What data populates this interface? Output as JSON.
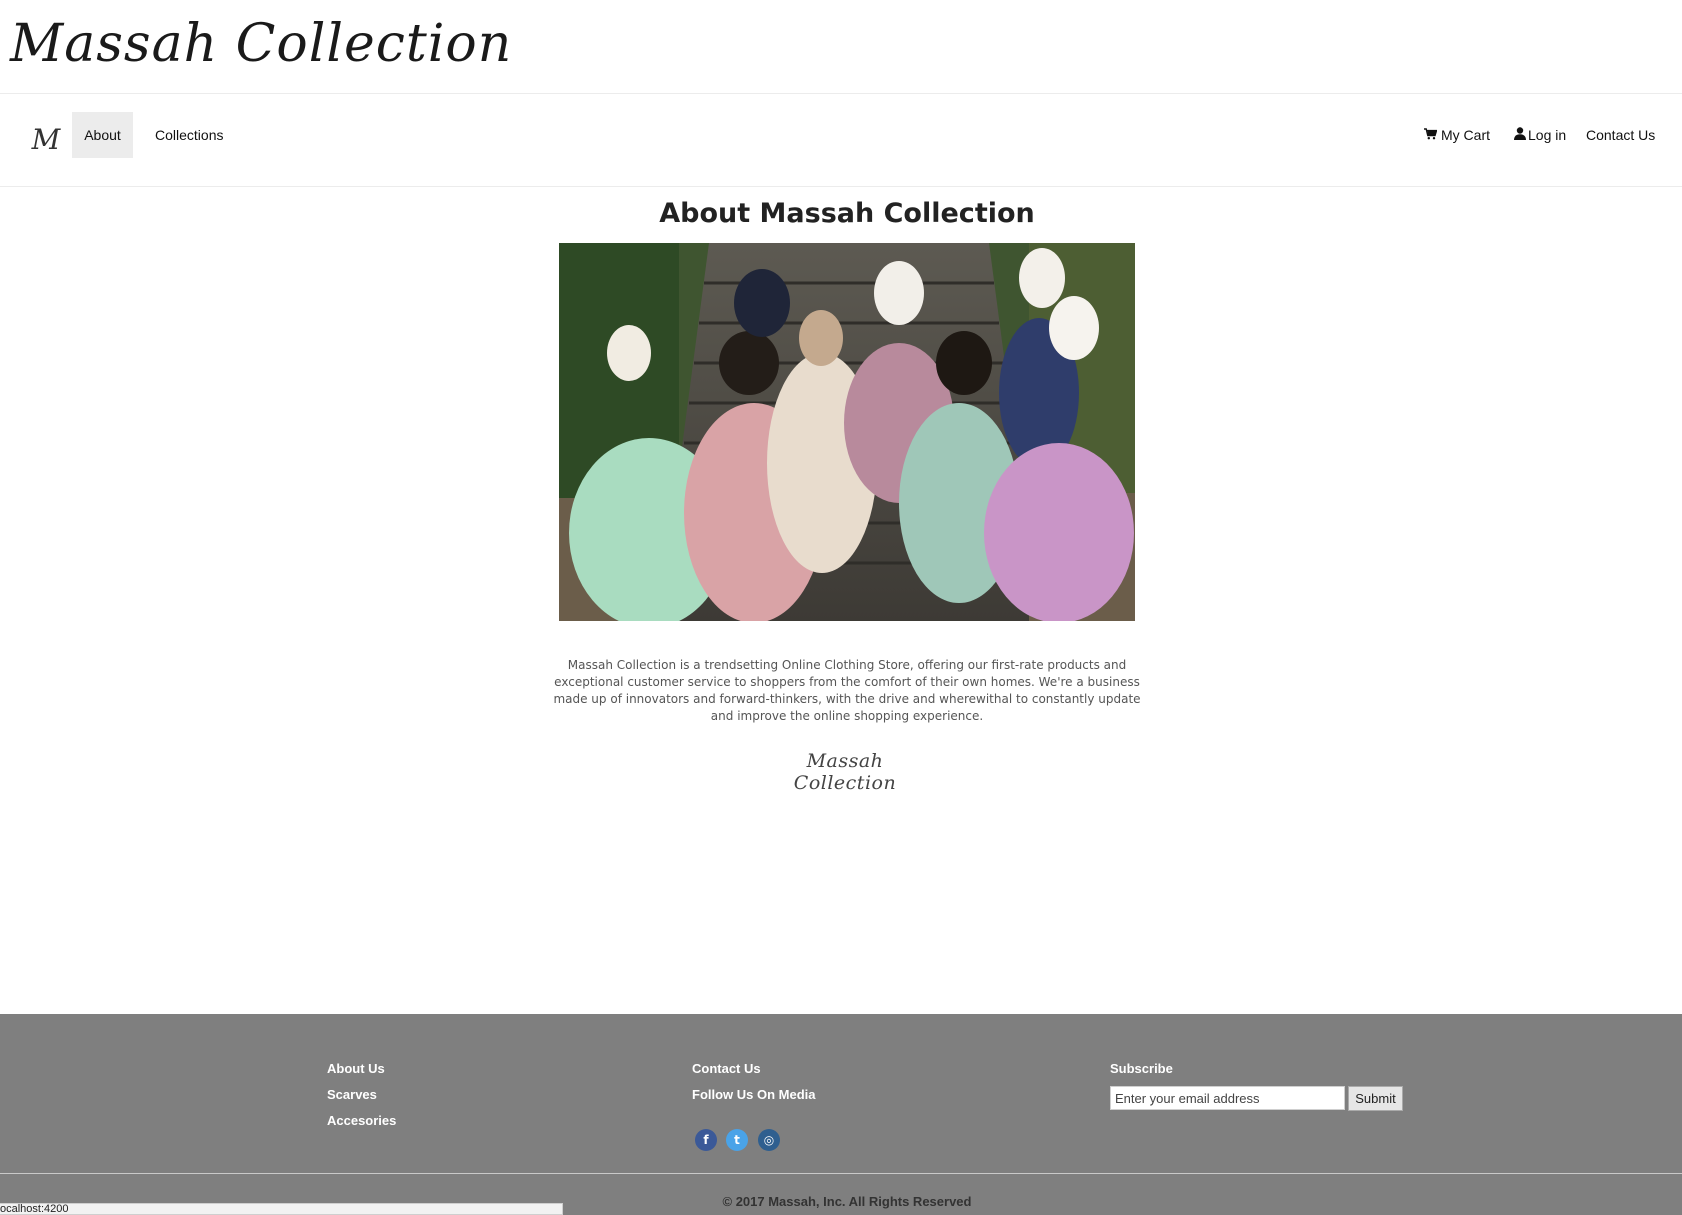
{
  "brand": {
    "logo_text": "Massah Collection",
    "monogram": "M"
  },
  "nav": {
    "about": "About",
    "collections": "Collections",
    "cart": "My Cart",
    "login": "Log in",
    "contact": "Contact Us"
  },
  "main": {
    "title": "About Massah Collection",
    "description": "Massah Collection is a trendsetting Online Clothing Store, offering our first-rate products and exceptional customer service to shoppers from the comfort of their own homes. We're a business made up of innovators and forward-thinkers, with the drive and wherewithal to constantly update and improve the online shopping experience.",
    "signature": "Massah Collection"
  },
  "footer": {
    "about_us": "About Us",
    "scarves": "Scarves",
    "accessories": "Accesories",
    "contact_us": "Contact Us",
    "follow": "Follow Us On Media",
    "social": {
      "facebook": "f",
      "twitter": "t",
      "instagram": "◎"
    },
    "subscribe": "Subscribe",
    "email_placeholder": "Enter your email address",
    "submit": "Submit",
    "copyright": "© 2017 Massah, Inc. All Rights Reserved"
  },
  "status": {
    "url": "ocalhost:4200"
  },
  "colors": {
    "footer_bg": "#7f7f7f",
    "nav_active_bg": "#ececec",
    "text": "#222222"
  },
  "icons": {
    "cart": "cart-icon",
    "login": "user-icon"
  }
}
